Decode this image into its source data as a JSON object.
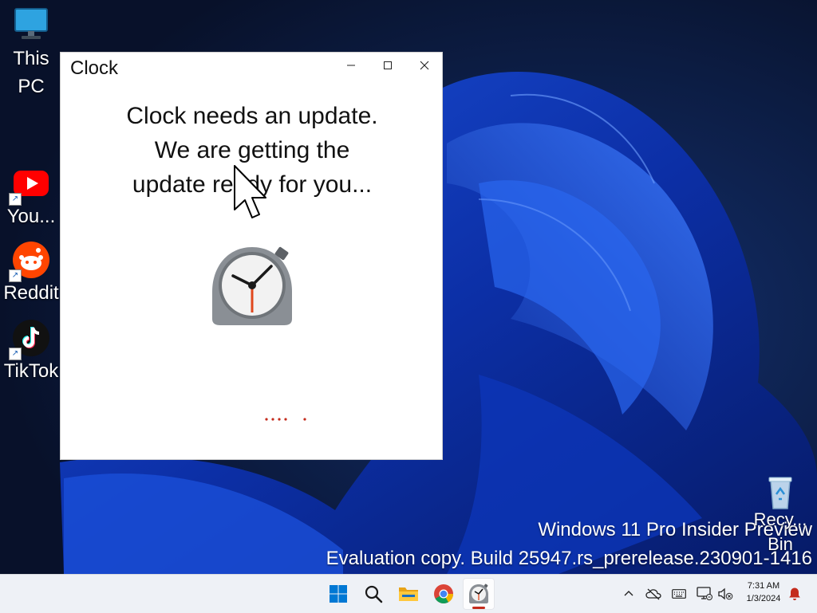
{
  "desktop": {
    "icons": [
      {
        "name": "This PC",
        "icon": "monitor-icon"
      },
      {
        "name": "You...",
        "icon": "youtube-icon"
      },
      {
        "name": "Reddit",
        "icon": "reddit-icon"
      },
      {
        "name": "TikTok",
        "icon": "tiktok-icon"
      }
    ],
    "recycle_bin": {
      "label": "Recy... Bin",
      "label_line1": "Recy...",
      "label_line2": "Bin",
      "icon": "recycle-bin-icon"
    },
    "watermark": {
      "line1": "Windows 11 Pro Insider Preview",
      "line2": "Evaluation copy. Build 25947.rs_prerelease.230901-1416"
    }
  },
  "window": {
    "title": "Clock",
    "controls": [
      "minimize-icon",
      "maximize-icon",
      "close-icon"
    ],
    "message_lines": [
      "Clock needs an update.",
      "We are getting the",
      "update ready for you..."
    ],
    "progress_color": "#c42b1c"
  },
  "taskbar": {
    "apps": [
      "start-icon",
      "search-icon",
      "file-explorer-icon",
      "chrome-icon",
      "clock-app-icon"
    ],
    "active_app": "clock-app-icon",
    "tray": {
      "time": "7:31 AM",
      "date": "1/3/2024",
      "icons": [
        "chevron-up-icon",
        "cloud-off-icon",
        "keyboard-icon",
        "network-icon",
        "volume-muted-icon",
        "notification-bell-icon"
      ]
    }
  },
  "colors": {
    "accent": "#0067c0",
    "taskbar_bg": "#eef1f6",
    "notification": "#c42b1c"
  }
}
